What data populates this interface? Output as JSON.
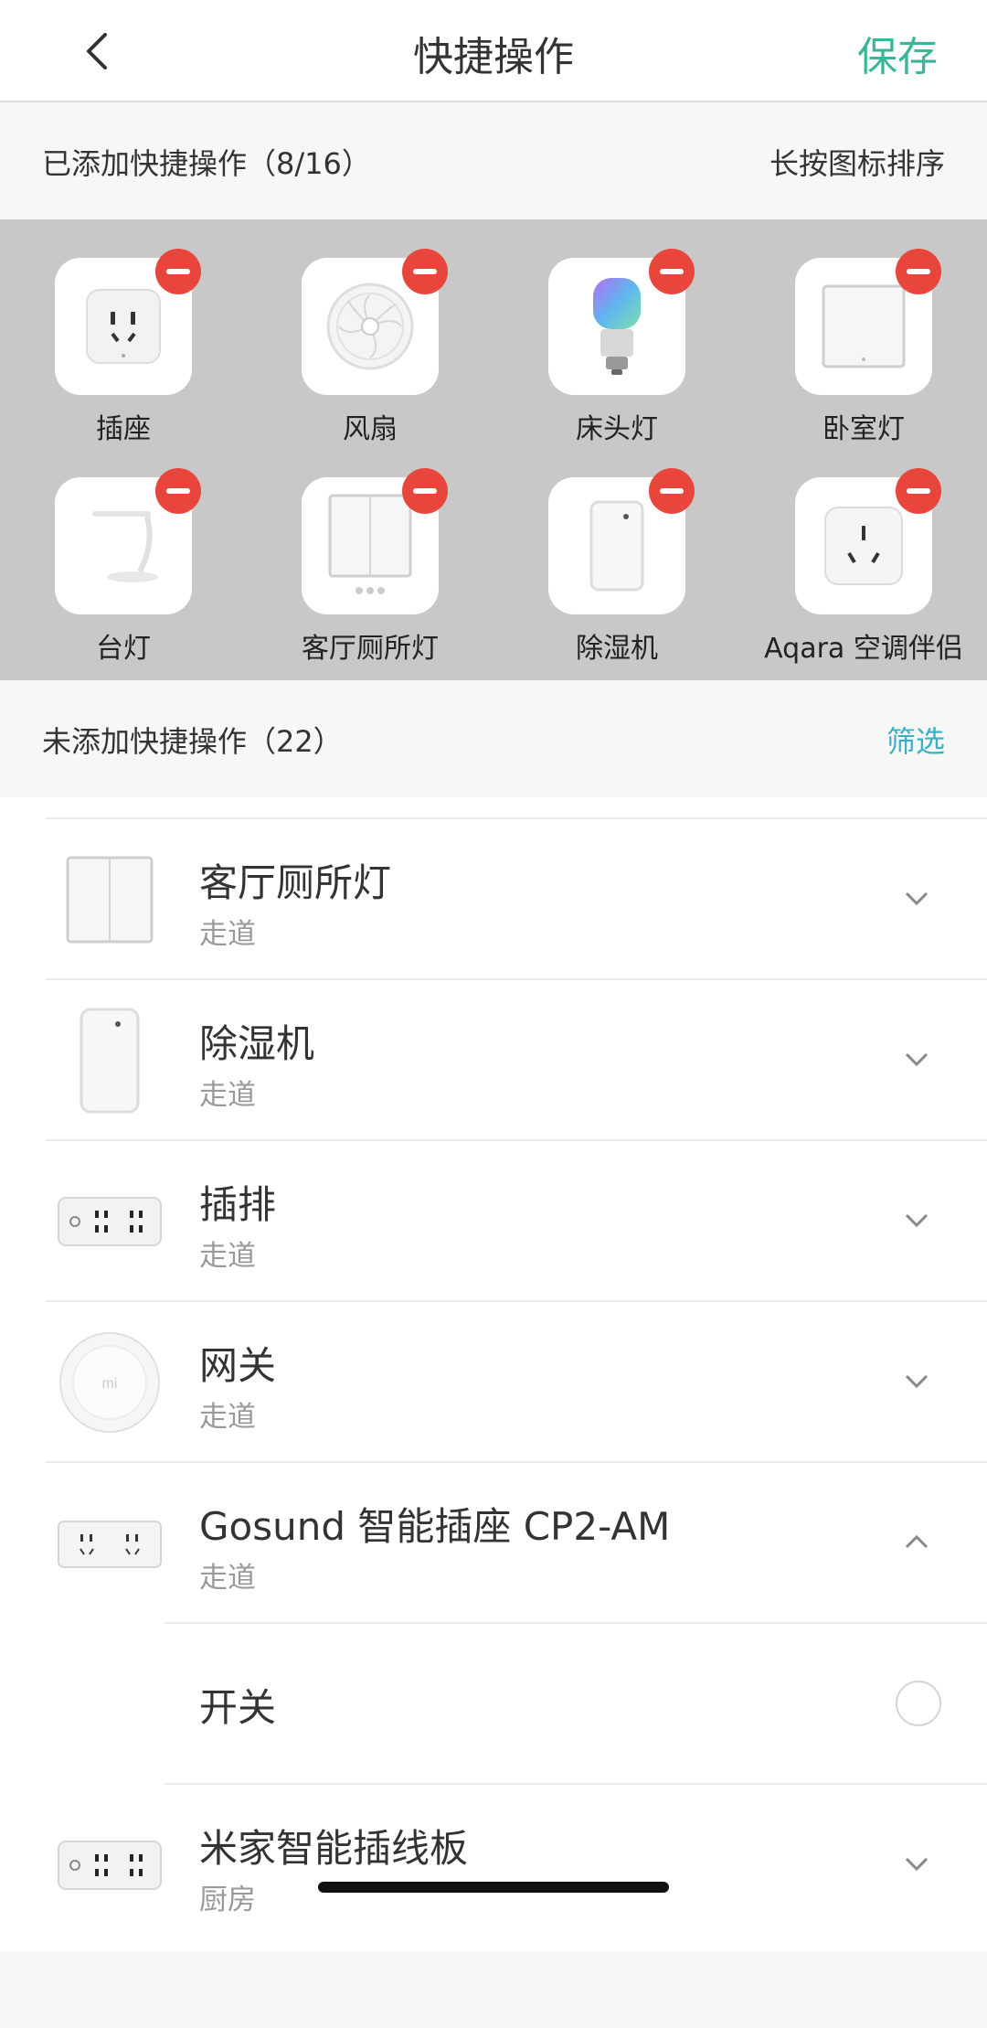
{
  "header": {
    "title": "快捷操作",
    "save_label": "保存",
    "back_icon": "chevron-left-icon",
    "accent_color": "#3bb59a"
  },
  "added_section": {
    "title": "已添加快捷操作（8/16）",
    "hint": "长按图标排序",
    "items": [
      {
        "label": "插座",
        "icon": "socket-icon"
      },
      {
        "label": "风扇",
        "icon": "fan-icon"
      },
      {
        "label": "床头灯",
        "icon": "bulb-icon"
      },
      {
        "label": "卧室灯",
        "icon": "wall-switch-icon"
      },
      {
        "label": "台灯",
        "icon": "desk-lamp-icon"
      },
      {
        "label": "客厅厕所灯",
        "icon": "double-switch-icon"
      },
      {
        "label": "除湿机",
        "icon": "dehumidifier-icon"
      },
      {
        "label": "Aqara 空调伴侣",
        "icon": "ac-companion-icon"
      }
    ],
    "remove_color": "#e8453c"
  },
  "not_added_section": {
    "title": "未添加快捷操作（22）",
    "filter_label": "筛选",
    "filter_color": "#3bb0c4"
  },
  "list": {
    "items": [
      {
        "name": "客厅厕所灯",
        "room": "走道",
        "icon": "double-switch-icon",
        "expanded": false
      },
      {
        "name": "除湿机",
        "room": "走道",
        "icon": "dehumidifier-icon",
        "expanded": false
      },
      {
        "name": "插排",
        "room": "走道",
        "icon": "power-strip-icon",
        "expanded": false
      },
      {
        "name": "网关",
        "room": "走道",
        "icon": "gateway-icon",
        "expanded": false
      },
      {
        "name": "Gosund 智能插座 CP2-AM",
        "room": "走道",
        "icon": "smart-plug-icon",
        "expanded": true
      },
      {
        "name": "米家智能插线板",
        "room": "厨房",
        "icon": "power-strip-icon",
        "expanded": false
      }
    ],
    "sub_action": {
      "label": "开关",
      "selected": false
    }
  }
}
